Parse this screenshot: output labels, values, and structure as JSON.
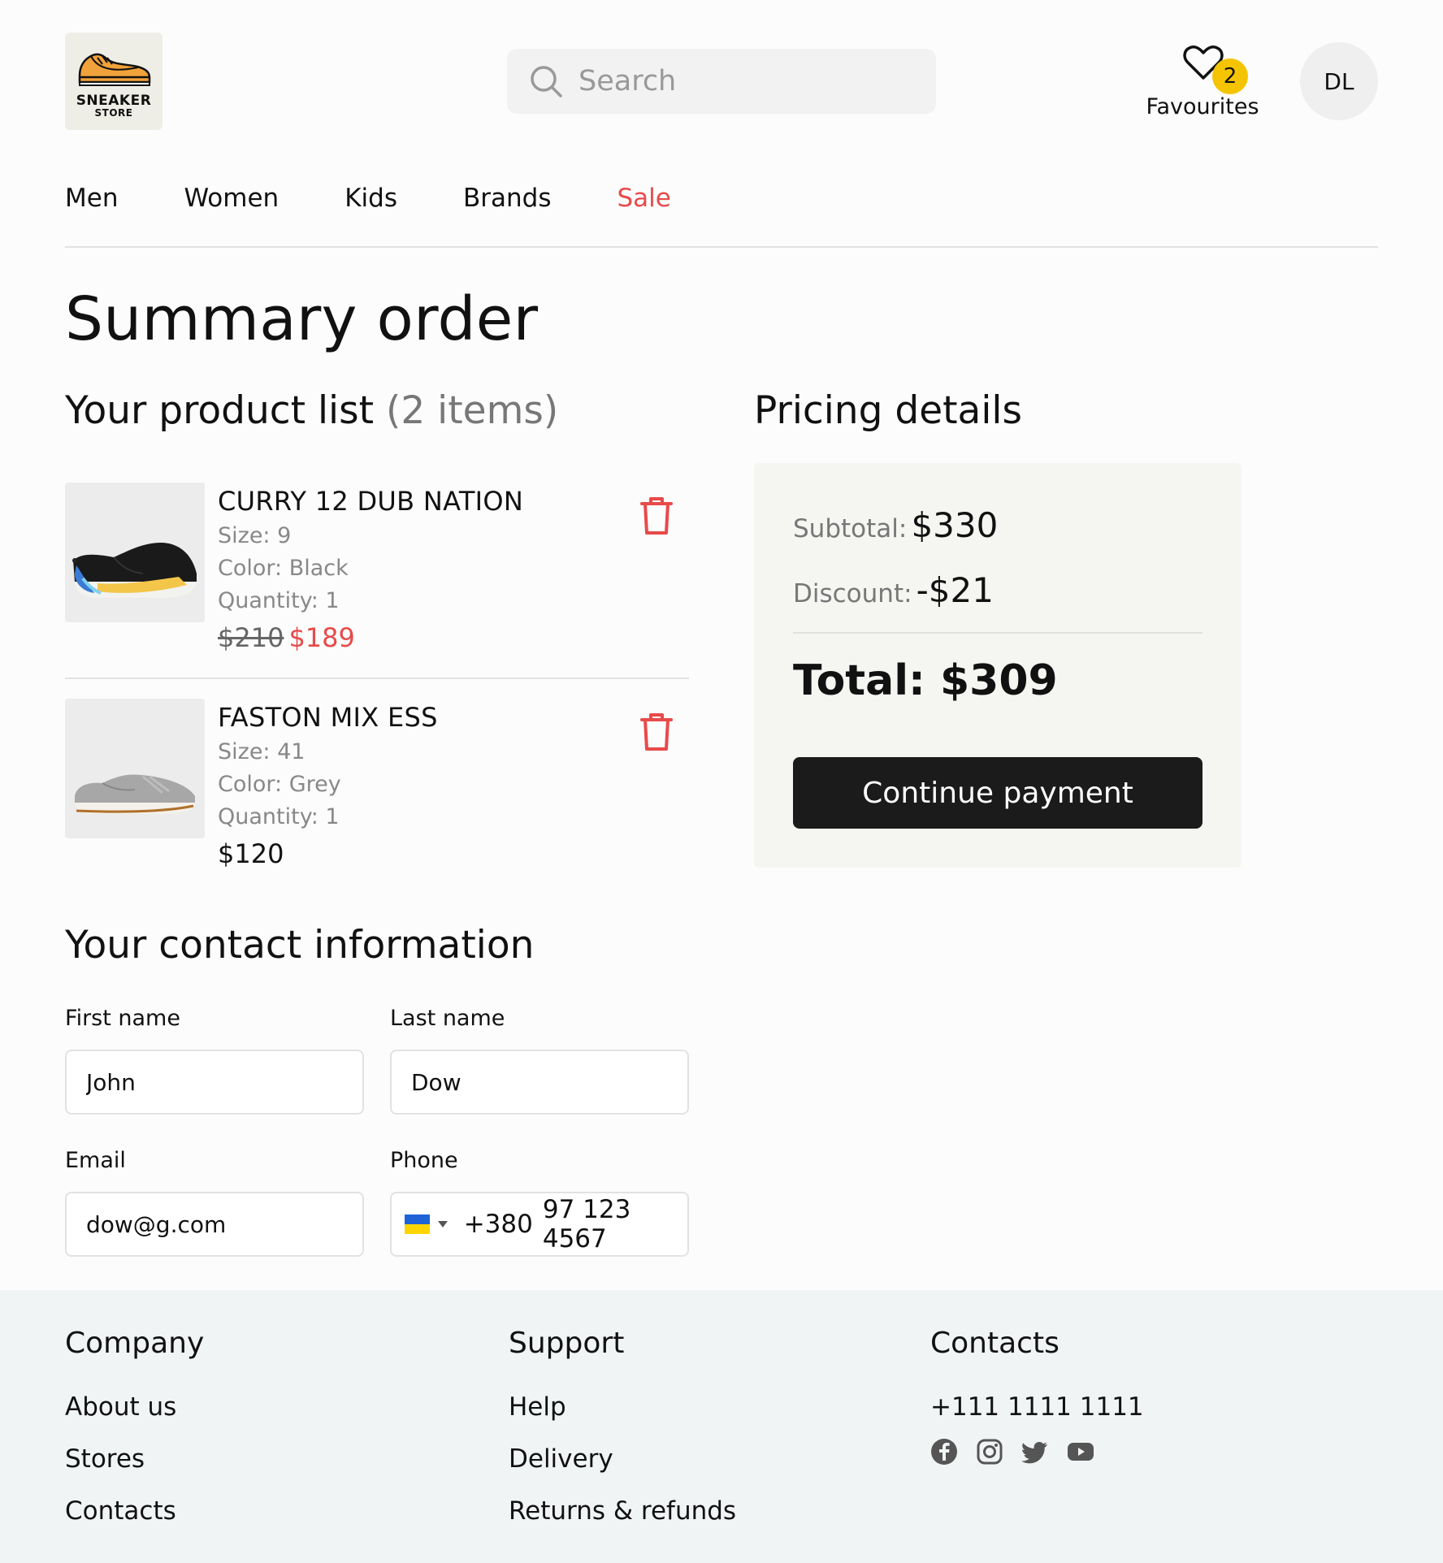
{
  "header": {
    "logo_line1": "SNEAKER",
    "logo_line2": "STORE",
    "search_placeholder": "Search",
    "favourites_label": "Favourites",
    "favourites_count": "2",
    "avatar_initials": "DL"
  },
  "nav": {
    "items": [
      "Men",
      "Women",
      "Kids",
      "Brands",
      "Sale"
    ]
  },
  "page_title": "Summary order",
  "product_list": {
    "heading": "Your product list",
    "count_label": "(2 items)",
    "items": [
      {
        "name": "CURRY 12 DUB NATION",
        "size": "Size: 9",
        "color": "Color: Black",
        "quantity": "Quantity: 1",
        "old_price": "$210",
        "price": "$189"
      },
      {
        "name": "FASTON MIX ESS",
        "size": "Size: 41",
        "color": "Color: Grey",
        "quantity": "Quantity: 1",
        "price": "$120"
      }
    ]
  },
  "pricing": {
    "heading": "Pricing details",
    "subtotal_label": "Subtotal:",
    "subtotal_value": "$330",
    "discount_label": "Discount:",
    "discount_value": "-$21",
    "total": "Total: $309",
    "button_label": "Continue payment"
  },
  "contact": {
    "heading": "Your contact information",
    "first_name_label": "First name",
    "first_name_value": "John",
    "last_name_label": "Last name",
    "last_name_value": "Dow",
    "email_label": "Email",
    "email_value": "dow@g.com",
    "phone_label": "Phone",
    "phone_code": "+380",
    "phone_number": "97 123 4567"
  },
  "footer": {
    "company_heading": "Company",
    "company_links": [
      "About us",
      "Stores",
      "Contacts"
    ],
    "support_heading": "Support",
    "support_links": [
      "Help",
      "Delivery",
      "Returns & refunds"
    ],
    "contacts_heading": "Contacts",
    "phone": "+111 1111 1111",
    "social_icons": [
      "facebook-icon",
      "instagram-icon",
      "twitter-icon",
      "youtube-icon"
    ]
  },
  "colors": {
    "accent_red": "#e84a4a",
    "badge_yellow": "#f5c400",
    "button_dark": "#1b1b1b"
  }
}
